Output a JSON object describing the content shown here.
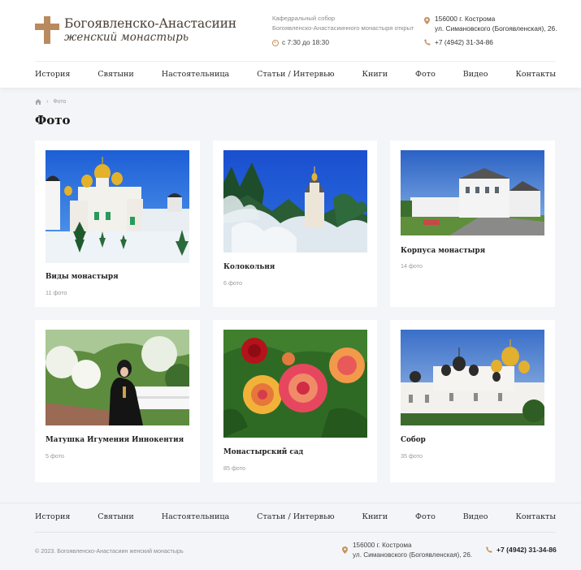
{
  "header": {
    "logo_title": "Богоявленско-Анастасиин",
    "logo_subtitle": "женский монастырь",
    "info_line1": "Кафедральный собор",
    "info_line2": "Богоявленско-Анастасиинного монастыря открыт",
    "hours": "с 7:30 до 18:30",
    "address_line1": "156000 г. Кострома",
    "address_line2": "ул. Симановского (Богоявленская), 26.",
    "phone": "+7 (4942) 31-34-86"
  },
  "nav": {
    "items": [
      "История",
      "Святыни",
      "Настоятельница",
      "Статьи / Интервью",
      "Книги",
      "Фото",
      "Видео",
      "Контакты"
    ]
  },
  "breadcrumb": {
    "current": "Фото"
  },
  "page": {
    "title": "Фото"
  },
  "albums": [
    {
      "title": "Виды монастыря",
      "count": "11 фото"
    },
    {
      "title": "Колокольня",
      "count": "6 фото"
    },
    {
      "title": "Корпуса монастыря",
      "count": "14 фото"
    },
    {
      "title": "Матушка Игумения Иннокентия",
      "count": "5 фото"
    },
    {
      "title": "Монастырский сад",
      "count": "85 фото"
    },
    {
      "title": "Собор",
      "count": "35 фото"
    }
  ],
  "footer": {
    "nav": [
      "История",
      "Святыни",
      "Настоятельница",
      "Статьи / Интервью",
      "Книги",
      "Фото",
      "Видео",
      "Контакты"
    ],
    "copyright": "© 2023. Богоявленско-Анастасиин женский монастырь",
    "address_line1": "156000 г. Кострома",
    "address_line2": "ул. Симановского (Богоявленская), 26.",
    "phone": "+7 (4942) 31-34-86"
  },
  "colors": {
    "accent": "#c6925f",
    "background": "#f4f5f8",
    "card": "#ffffff"
  }
}
